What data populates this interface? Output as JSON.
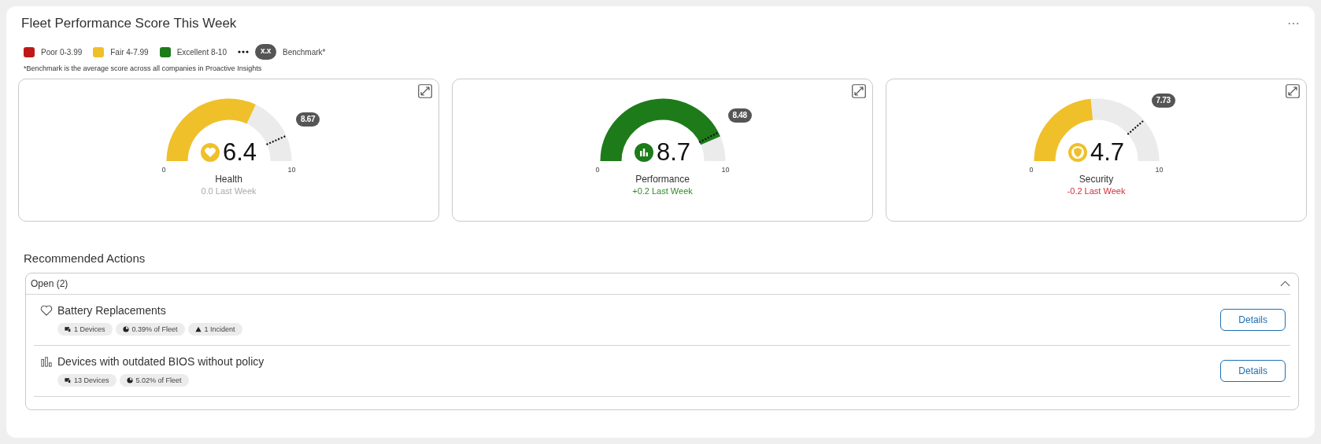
{
  "title": "Fleet Performance Score This Week",
  "legend": [
    {
      "label": "Poor 0-3.99",
      "color": "#c01818"
    },
    {
      "label": "Fair 4-7.99",
      "color": "#f0c02a"
    },
    {
      "label": "Excellent 8-10",
      "color": "#1e7b1a"
    }
  ],
  "benchmark_legend": {
    "badge": "x.x",
    "label": "Benchmark*"
  },
  "footnote": "*Benchmark is the average score across all companies in Proactive Insights",
  "gauges": [
    {
      "name": "Health",
      "kind": "heart",
      "score": "6.4",
      "color": "#f0c02a",
      "benchmark": "8.67",
      "min": "0",
      "max": "10",
      "change": {
        "text": "0.0 Last Week",
        "color": "#aaaaaa"
      }
    },
    {
      "name": "Performance",
      "kind": "chart",
      "score": "8.7",
      "color": "#1e7b1a",
      "benchmark": "8.48",
      "min": "0",
      "max": "10",
      "change": {
        "text": "+0.2 Last Week",
        "color": "#2f8a2a"
      }
    },
    {
      "name": "Security",
      "kind": "shield",
      "score": "4.7",
      "color": "#f0c02a",
      "benchmark": "7.73",
      "min": "0",
      "max": "10",
      "change": {
        "text": "-0.2 Last Week",
        "color": "#d0313a"
      }
    }
  ],
  "actions_title": "Recommended Actions",
  "actions": {
    "header": "Open (2)",
    "expanded": true,
    "items": [
      {
        "kind": "heart",
        "title": "Battery Replacements",
        "chips": [
          {
            "kind": "devices",
            "text": "1 Devices"
          },
          {
            "kind": "fleet",
            "text": "0.39% of Fleet"
          },
          {
            "kind": "incident",
            "text": "1 Incident"
          }
        ],
        "button": "Details"
      },
      {
        "kind": "chart",
        "title": "Devices with outdated BIOS without policy",
        "chips": [
          {
            "kind": "devices",
            "text": "13 Devices"
          },
          {
            "kind": "fleet",
            "text": "5.02% of Fleet"
          }
        ],
        "button": "Details"
      }
    ]
  }
}
